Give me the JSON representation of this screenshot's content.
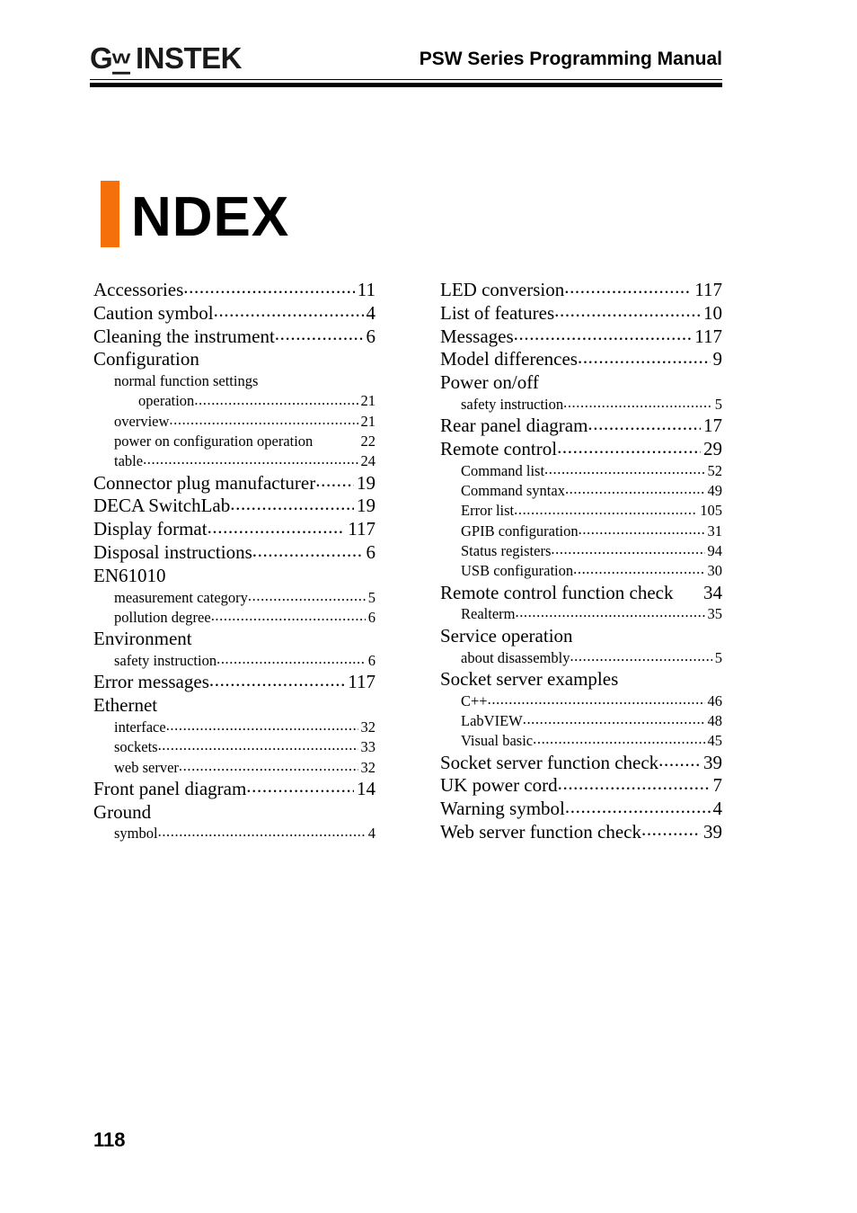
{
  "header": {
    "logo_g": "G",
    "logo_w": "W",
    "logo_rest": "INSTEK",
    "manual_title": "PSW Series Programming Manual"
  },
  "heading": {
    "initial": "I",
    "rest": "NDEX",
    "accent_color": "#F5700A"
  },
  "footer": {
    "page_number": "118"
  },
  "index": {
    "left_column": [
      {
        "level": "main",
        "label": "Accessories",
        "page": "11",
        "leader": true
      },
      {
        "level": "main",
        "label": "Caution symbol",
        "page": "4",
        "leader": true
      },
      {
        "level": "main",
        "label": "Cleaning the instrument",
        "page": "6",
        "leader": true
      },
      {
        "level": "main",
        "label": "Configuration",
        "page": "",
        "leader": false
      },
      {
        "level": "sub",
        "label": "normal function settings",
        "page": "",
        "leader": false
      },
      {
        "level": "subsub",
        "label": "operation",
        "page": "21",
        "leader": true
      },
      {
        "level": "sub",
        "label": "overview",
        "page": "21",
        "leader": true
      },
      {
        "level": "sub",
        "label": "power on configuration operation",
        "page": "22",
        "leader": false
      },
      {
        "level": "sub",
        "label": "table",
        "page": "24",
        "leader": true
      },
      {
        "level": "main",
        "label": "Connector plug manufacturer",
        "page": "19",
        "leader": true
      },
      {
        "level": "main",
        "label": "DECA SwitchLab",
        "page": "19",
        "leader": true
      },
      {
        "level": "main",
        "label": "Display format",
        "page": "117",
        "leader": true
      },
      {
        "level": "main",
        "label": "Disposal instructions",
        "page": "6",
        "leader": true
      },
      {
        "level": "main",
        "label": "EN61010",
        "page": "",
        "leader": false
      },
      {
        "level": "sub",
        "label": "measurement category",
        "page": "5",
        "leader": true
      },
      {
        "level": "sub",
        "label": "pollution degree",
        "page": "6",
        "leader": true
      },
      {
        "level": "main",
        "label": "Environment",
        "page": "",
        "leader": false
      },
      {
        "level": "sub",
        "label": "safety instruction",
        "page": "6",
        "leader": true
      },
      {
        "level": "main",
        "label": "Error messages",
        "page": "117",
        "leader": true
      },
      {
        "level": "main",
        "label": "Ethernet",
        "page": "",
        "leader": false
      },
      {
        "level": "sub",
        "label": "interface",
        "page": "32",
        "leader": true
      },
      {
        "level": "sub",
        "label": "sockets",
        "page": "33",
        "leader": true
      },
      {
        "level": "sub",
        "label": "web server",
        "page": "32",
        "leader": true
      },
      {
        "level": "main",
        "label": "Front panel diagram",
        "page": "14",
        "leader": true
      },
      {
        "level": "main",
        "label": "Ground",
        "page": "",
        "leader": false
      },
      {
        "level": "sub",
        "label": "symbol",
        "page": "4",
        "leader": true
      }
    ],
    "right_column": [
      {
        "level": "main",
        "label": "LED conversion",
        "page": "117",
        "leader": true
      },
      {
        "level": "main",
        "label": "List of features",
        "page": "10",
        "leader": true
      },
      {
        "level": "main",
        "label": "Messages",
        "page": "117",
        "leader": true
      },
      {
        "level": "main",
        "label": "Model differences",
        "page": "9",
        "leader": true
      },
      {
        "level": "main",
        "label": "Power on/off",
        "page": "",
        "leader": false
      },
      {
        "level": "sub",
        "label": "safety instruction",
        "page": "5",
        "leader": true
      },
      {
        "level": "main",
        "label": "Rear panel diagram",
        "page": "17",
        "leader": true
      },
      {
        "level": "main",
        "label": "Remote control",
        "page": "29",
        "leader": true
      },
      {
        "level": "sub",
        "label": "Command list",
        "page": "52",
        "leader": true
      },
      {
        "level": "sub",
        "label": "Command syntax",
        "page": "49",
        "leader": true
      },
      {
        "level": "sub",
        "label": "Error list",
        "page": "105",
        "leader": true
      },
      {
        "level": "sub",
        "label": "GPIB configuration",
        "page": "31",
        "leader": true
      },
      {
        "level": "sub",
        "label": "Status registers",
        "page": "94",
        "leader": true
      },
      {
        "level": "sub",
        "label": "USB configuration",
        "page": "30",
        "leader": true
      },
      {
        "level": "main",
        "label": "Remote control function check",
        "page": "34",
        "leader": false
      },
      {
        "level": "sub",
        "label": "Realterm",
        "page": "35",
        "leader": true
      },
      {
        "level": "main",
        "label": "Service operation",
        "page": "",
        "leader": false
      },
      {
        "level": "sub",
        "label": "about disassembly",
        "page": "5",
        "leader": true
      },
      {
        "level": "main",
        "label": "Socket server examples",
        "page": "",
        "leader": false
      },
      {
        "level": "sub",
        "label": "C++",
        "page": "46",
        "leader": true
      },
      {
        "level": "sub",
        "label": "LabVIEW",
        "page": "48",
        "leader": true
      },
      {
        "level": "sub",
        "label": "Visual basic",
        "page": "45",
        "leader": true
      },
      {
        "level": "main",
        "label": "Socket server function check",
        "page": "39",
        "leader": true
      },
      {
        "level": "main",
        "label": "UK power cord",
        "page": "7",
        "leader": true
      },
      {
        "level": "main",
        "label": "Warning symbol",
        "page": "4",
        "leader": true
      },
      {
        "level": "main",
        "label": "Web server function check",
        "page": "39",
        "leader": true
      }
    ]
  }
}
